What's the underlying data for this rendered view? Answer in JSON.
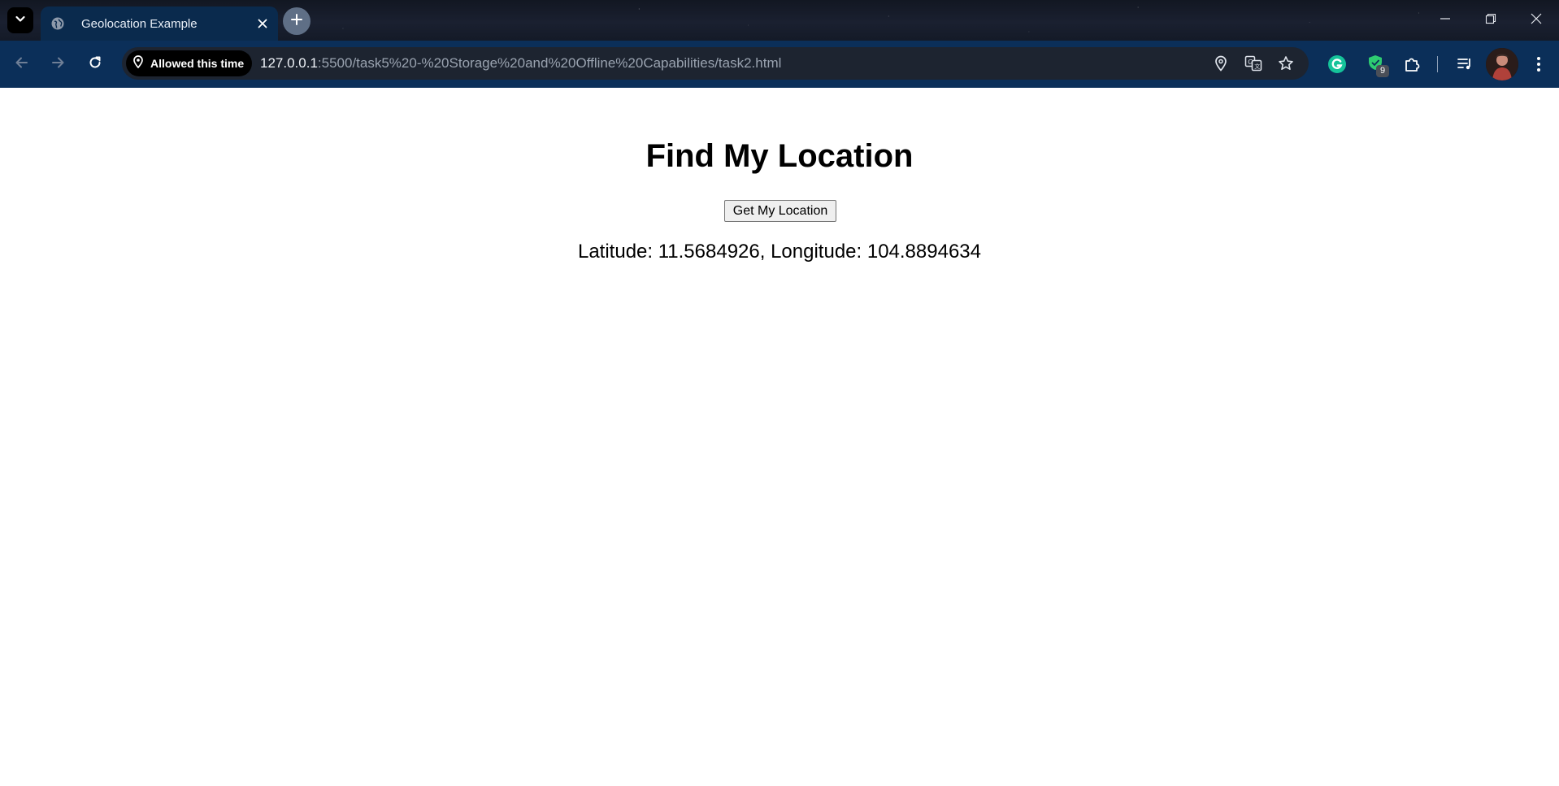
{
  "browser": {
    "tab": {
      "title": "Geolocation Example"
    },
    "omnibox": {
      "permission_chip": "Allowed this time",
      "url_host": "127.0.0.1",
      "url_rest": ":5500/task5%20-%20Storage%20and%20Offline%20Capabilities/task2.html"
    },
    "extensions": {
      "badge_count": "9"
    },
    "icons": {
      "tab_search": "chevron-down-icon",
      "favicon": "globe-icon",
      "tab_close": "close-icon",
      "new_tab": "plus-icon",
      "back": "arrow-left-icon",
      "forward": "arrow-right-icon",
      "reload": "reload-icon",
      "location": "location-pin-icon",
      "translate": "translate-icon",
      "bookmark": "star-icon",
      "grammarly": "grammarly-icon",
      "extensions_puzzle": "puzzle-icon",
      "media": "media-queue-icon",
      "menu": "kebab-menu-icon"
    },
    "colors": {
      "toolbar": "#0b2f59",
      "tab_active": "#0a2a4d",
      "omnibox": "#1d2430"
    }
  },
  "page": {
    "heading": "Find My Location",
    "button_label": "Get My Location",
    "result_text": "Latitude: 11.5684926, Longitude: 104.8894634"
  }
}
